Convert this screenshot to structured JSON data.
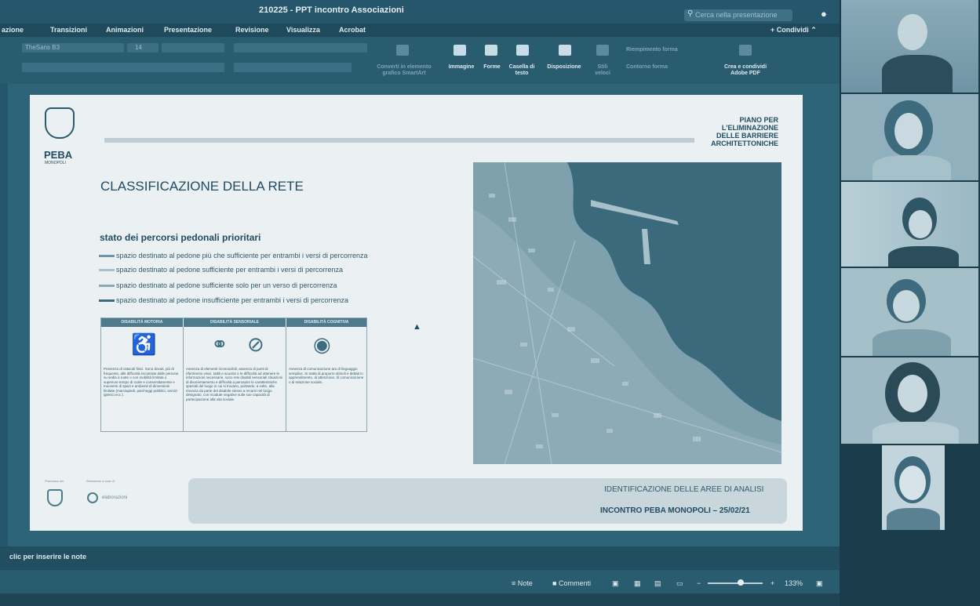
{
  "window": {
    "title": "210225 - PPT incontro Associazioni",
    "search_placeholder": "Cerca nella presentazione",
    "share_label": "Condividi"
  },
  "ribbon": {
    "tabs": [
      "azione",
      "Transizioni",
      "Animazioni",
      "Presentazione",
      "Revisione",
      "Visualizza",
      "Acrobat"
    ],
    "font_name": "TheSans B3",
    "font_size": "14",
    "buttons": {
      "convert_smartart": "Converti in elemento grafico SmartArt",
      "image": "Immagine",
      "shapes": "Forme",
      "textbox": "Casella di testo",
      "arrange": "Disposizione",
      "quick_styles": "Stili veloci",
      "shape_fill": "Riempimento forma",
      "shape_outline": "Contorno forma",
      "create_pdf": "Crea e condividi Adobe PDF"
    }
  },
  "slide": {
    "logo_text": "PEBA",
    "logo_sub": "MONOPOLI",
    "heading_right": [
      "PIANO PER",
      "L'ELIMINAZIONE",
      "DELLE BARRIERE",
      "ARCHITETTONICHE"
    ],
    "title": "CLASSIFICAZIONE DELLA RETE",
    "legend_title": "stato dei percorsi pedonali prioritari",
    "legend": [
      {
        "text": "spazio destinato al pedone più che sufficiente per entrambi i versi di percorrenza",
        "color": "#6f96a6"
      },
      {
        "text": "spazio destinato al pedone sufficiente per entrambi i versi di percorrenza",
        "color": "#a9c2cc"
      },
      {
        "text": "spazio destinato al pedone sufficiente solo per un verso di percorrenza",
        "color": "#8aa9b6"
      },
      {
        "text": "spazio destinato al pedone insufficiente per entrambi i versi di percorrenza",
        "color": "#3e6a7d"
      }
    ],
    "table": {
      "headers": [
        "DISABILITÀ MOTORIA",
        "DISABILITÀ SENSORIALE",
        "DISABILITÀ COGNITIVA"
      ],
      "cells": [
        "Presenza di ostacoli fisici. Sono dovuti, più di frequente, alle difficoltà incontrate dalle persone su sedia a ruote o con mobilità limitata o superiore tempo di scale e consentitamente e muoversi di spazi e ambienti di dimensioni limitate (marciapiedi, parcheggi pubblici, servizi igienici ecc.).",
        "Assenza di elementi riconoscibili, assenza di punti di riferimento visivi, tattili e acustici e le difficoltà ad ottenere le informazioni necessarie, sono resi disabili sensoriali situazioni di disorientamento e difficoltà a percepire le caratteristiche spaziali del luogo in cui si trovano, portando, a volte, alla rinuncia da parte del disabile stesso a recarsi nel luogo designato, con ricadute negative sulle sue capacità di partecipazione alla vita sociale.",
        "Assenza di comunicazione ara di linguaggio semplice. Si tratta di proporre stimoli e dettati in apprendimento, di attenzione, di comunicazione o di relazione sociale."
      ]
    },
    "band_line1": "IDENTIFICAZIONE DELLE AREE DI ANALISI",
    "band_line2": "INCONTRO PEBA MONOPOLI – 25/02/21",
    "partner1_label": "Promosso da:",
    "partner2_label": "Redazione a cura di:",
    "partner2_name": "elaborazioni"
  },
  "notes": {
    "placeholder": "clic per inserire le note"
  },
  "statusbar": {
    "notes": "Note",
    "comments": "Commenti",
    "zoom": "133%"
  }
}
